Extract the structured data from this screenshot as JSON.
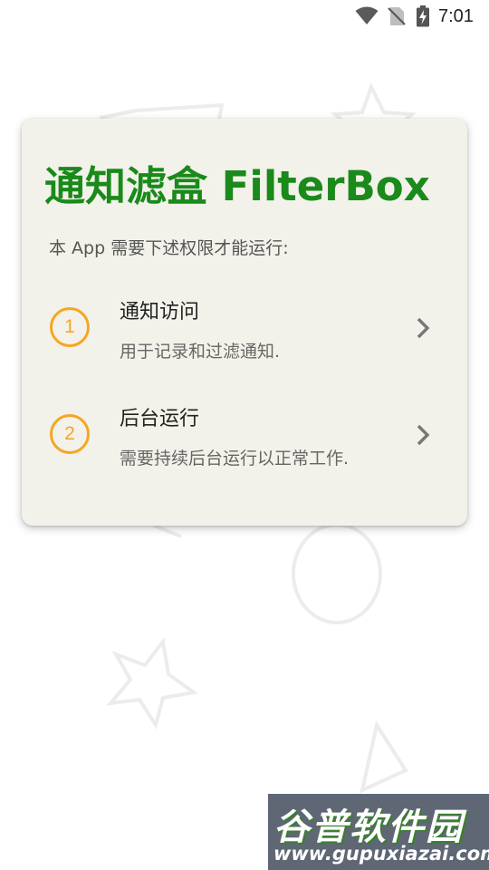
{
  "status_bar": {
    "time": "7:01",
    "icons": [
      "wifi-icon",
      "no-sim-icon",
      "battery-charging-icon"
    ]
  },
  "card": {
    "title": "通知滤盒 FilterBox",
    "subtitle": "本 App 需要下述权限才能运行:",
    "permissions": [
      {
        "number": "1",
        "title": "通知访问",
        "description": "用于记录和过滤通知."
      },
      {
        "number": "2",
        "title": "后台运行",
        "description": "需要持续后台运行以正常工作."
      }
    ]
  },
  "watermark": {
    "name": "谷普软件园",
    "url": "www.gupuxiazai.com"
  },
  "colors": {
    "title_green": "#1a8a1a",
    "accent_orange": "#f5a623",
    "card_background": "#f3f2ea"
  }
}
